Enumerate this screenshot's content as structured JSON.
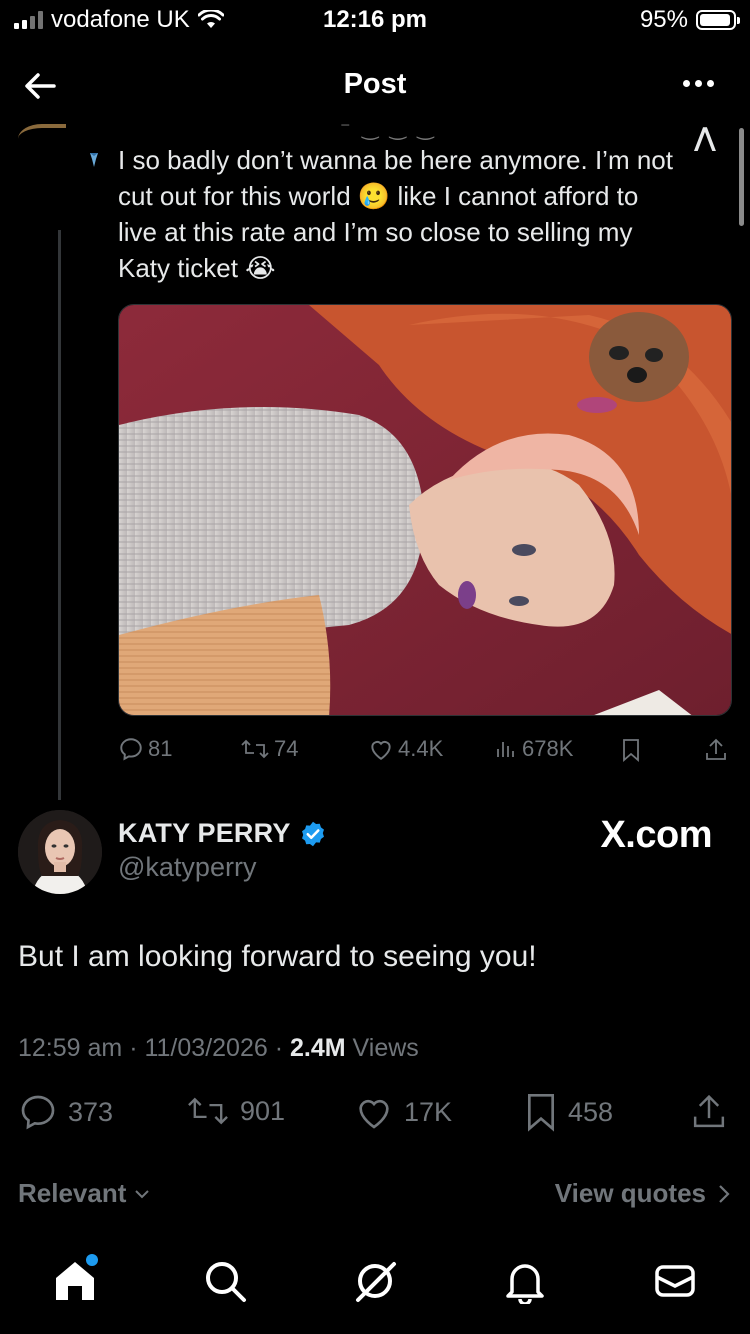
{
  "status_bar": {
    "carrier": "vodafone UK",
    "time": "12:16 pm",
    "battery": "95%",
    "battery_level": 0.95
  },
  "top_bar": {
    "title": "Post"
  },
  "parent_post": {
    "text_lines": [
      "I so badly don’t wanna be here anymore. I’m not",
      "cut out for this world 🥲 like I cannot afford to",
      "live at this rate and I’m so close to selling my",
      "Katy ticket 😭"
    ],
    "actions": {
      "replies": "81",
      "reposts": "74",
      "likes": "4.4K",
      "views": "678K"
    }
  },
  "post": {
    "display_name": "KATY PERRY",
    "handle": "@katyperry",
    "watermark": "X.com",
    "text": "But I am looking forward to seeing you!",
    "time": "12:59 am",
    "date": "11/03/2026",
    "views_count": "2.4M",
    "views_label": "Views",
    "actions": {
      "replies": "373",
      "reposts": "901",
      "likes": "17K",
      "bookmarks": "458"
    }
  },
  "filters": {
    "sort_label": "Relevant",
    "quotes_label": "View quotes"
  },
  "colors": {
    "background": "#000000",
    "text": "#e7e9ea",
    "muted": "#71767b",
    "accent": "#1d9bf0"
  },
  "bottom_nav": [
    "home-icon",
    "search-icon",
    "grok-icon",
    "notifications-icon",
    "messages-icon"
  ]
}
